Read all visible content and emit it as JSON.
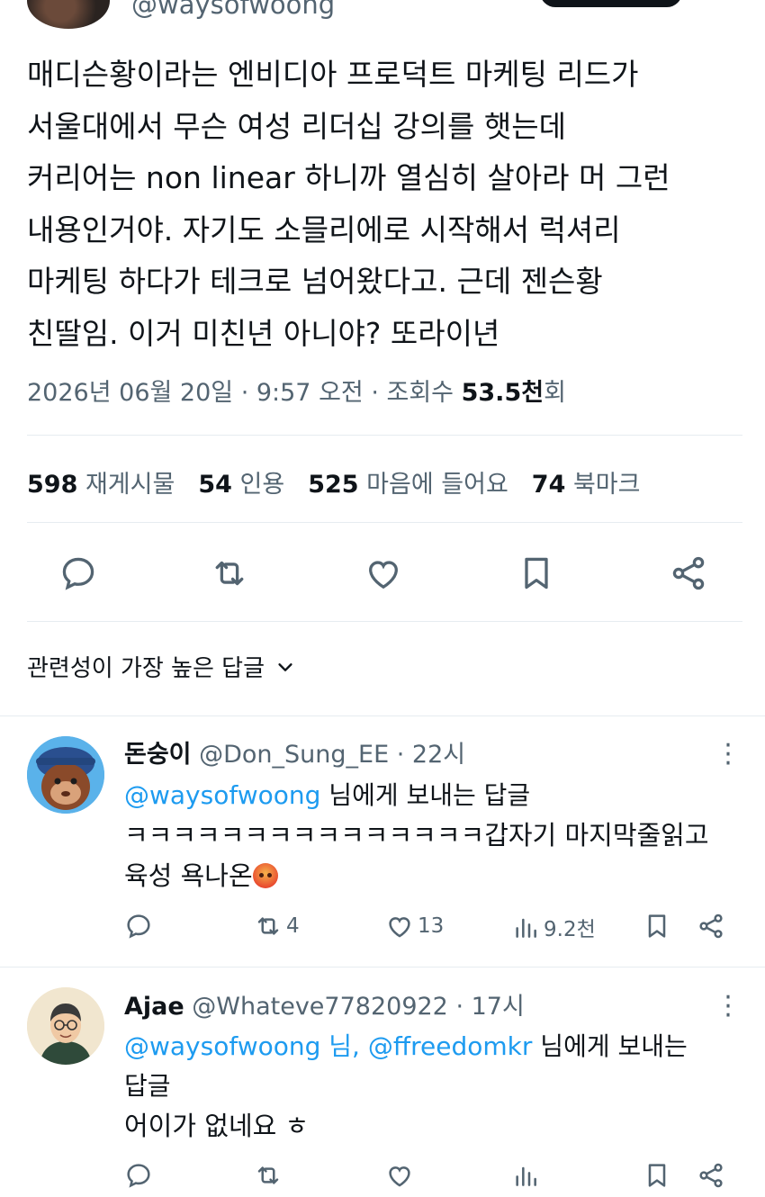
{
  "author": {
    "handle": "@waysofwoong"
  },
  "tweet": {
    "lines": [
      "매디슨황이라는 엔비디아 프로덕트 마케팅 리드가",
      "서울대에서 무슨 여성 리더십 강의를 햇는데",
      "커리어는 non linear 하니까 열심히 살아라 머 그런",
      "내용인거야. 자기도 소믈리에로 시작해서 럭셔리",
      "마케팅 하다가 테크로 넘어왔다고. 근데 젠슨황",
      "친딸임. 이거 미친년 아니야? 또라이년"
    ],
    "timestamp": "2026년 06월 20일 · 9:57 오전 · 조회수 ",
    "views": "53.5천",
    "views_suffix": "회"
  },
  "stats": [
    {
      "count": "598",
      "label": "재게시물"
    },
    {
      "count": "54",
      "label": "인용"
    },
    {
      "count": "525",
      "label": "마음에 들어요"
    },
    {
      "count": "74",
      "label": "북마크"
    }
  ],
  "action_icons": [
    "reply-icon",
    "retweet-icon",
    "like-icon",
    "bookmark-icon",
    "share-icon"
  ],
  "sort": {
    "label": "관련성이 가장 높은 답글"
  },
  "replies": [
    {
      "name": "돈숭이",
      "handle": "@Don_Sung_EE",
      "time": "· 22시",
      "to_mentions": "@waysofwoong",
      "to_suffix": " 님에게 보내는 답글",
      "body_line1": "ㅋㅋㅋㅋㅋㅋㅋㅋㅋㅋㅋㅋㅋㅋㅋ갑자기 마지막줄읽고",
      "body_line2": "육성 욕나온",
      "retweets": "4",
      "likes": "13",
      "views": "9.2천"
    },
    {
      "name": "Ajae",
      "handle": "@Whateve77820922",
      "time": "· 17시",
      "to_mentions": "@waysofwoong 님, @ffreedomkr",
      "to_suffix": " 님에게 보내는",
      "to_line2": "답글",
      "body_line1": "어이가 없네요 ㅎ"
    }
  ],
  "colors": {
    "accent": "#1d9bf0",
    "text": "#0f1419",
    "muted": "#536471",
    "divider": "#e6ecf0"
  }
}
